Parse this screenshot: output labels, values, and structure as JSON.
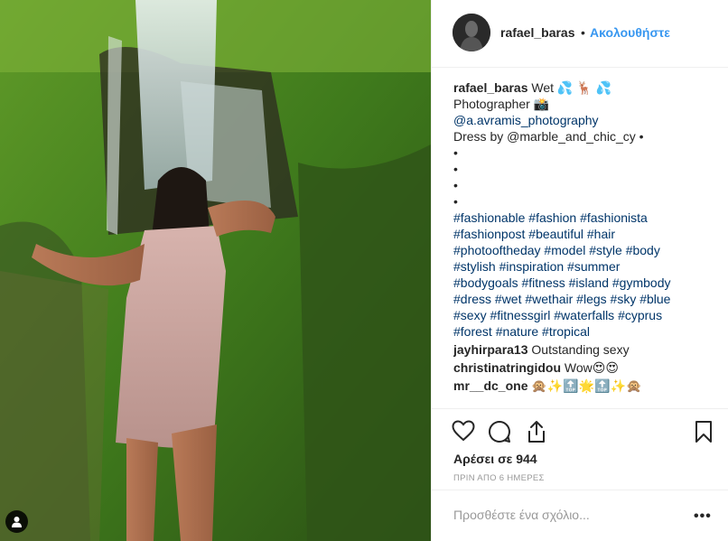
{
  "post": {
    "username": "rafael_baras",
    "separator": "•",
    "follow_label": "Ακολουθήστε",
    "caption": {
      "username": "rafael_baras",
      "lines": [
        "Wet 💦 🦌 💦",
        "Photographer 📸",
        "@a.avramis_photography",
        "Dress by @marble_and_chic_cy •",
        "•",
        "•",
        "•",
        "•",
        "#fashionable #fashion #fashionista",
        "#fashionpost #beautiful #hair",
        "#photooftheday #model #style #body",
        "#stylish #inspiration #summer",
        "#bodygoals #fitness #island #gymbody",
        "#dress #wet #wethair #legs #sky #blue",
        "#sexy #fitnessgirl #waterfalls #cyprus",
        "#forest #nature #tropical"
      ]
    },
    "comments": [
      {
        "username": "jayhirpara13",
        "text": "Outstanding sexy"
      },
      {
        "username": "christinatringidou",
        "text": "Wow😍😍"
      },
      {
        "username": "mr__dc_one",
        "text": "🙊✨🔝🌟🔝✨🙊"
      }
    ],
    "likes_text": "Αρέσει σε 944",
    "time_text": "ΠΡΙΝ ΑΠΟ 6 ΗΜΕΡΕΣ",
    "comment_placeholder": "Προσθέστε ένα σχόλιο...",
    "more_label": "•••",
    "icons": {
      "like": "heart-icon",
      "comment": "comment-icon",
      "share": "share-icon",
      "save": "bookmark-icon",
      "user_tag": "user-tag-icon"
    },
    "colors": {
      "link": "#003569",
      "follow": "#3897f0",
      "muted": "#999999",
      "text": "#262626"
    }
  }
}
